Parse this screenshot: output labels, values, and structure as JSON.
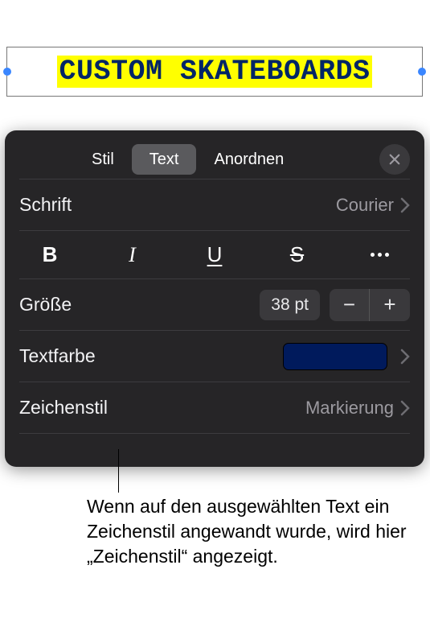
{
  "textbox": {
    "content": "CUSTOM SKATEBOARDS"
  },
  "tabs": {
    "style": "Stil",
    "text": "Text",
    "arrange": "Anordnen"
  },
  "font": {
    "label": "Schrift",
    "value": "Courier"
  },
  "styleButtons": {
    "bold": "B",
    "italic": "I",
    "underline": "U",
    "strike": "S"
  },
  "size": {
    "label": "Größe",
    "value": "38 pt"
  },
  "textColor": {
    "label": "Textfarbe",
    "hex": "#001a5c"
  },
  "charStyle": {
    "label": "Zeichenstil",
    "value": "Markierung"
  },
  "callout": "Wenn auf den ausgewählten Text ein Zeichenstil angewandt wurde, wird hier „Zeichenstil“ angezeigt."
}
